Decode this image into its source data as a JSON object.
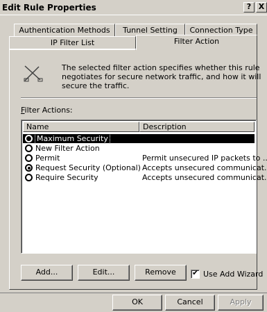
{
  "window": {
    "title": "Edit Rule Properties",
    "help_btn": "?",
    "close_btn": "X"
  },
  "tabs": {
    "row_back": [
      "Authentication Methods",
      "Tunnel Setting",
      "Connection Type"
    ],
    "row_front": [
      "IP Filter List",
      "Filter Action"
    ],
    "active": "Filter Action"
  },
  "info": {
    "icon": "filter-action-icon",
    "text": "The selected filter action specifies whether this rule negotiates for secure network traffic, and how it will secure the traffic."
  },
  "filter_actions": {
    "label_prefix": "",
    "label_underline": "F",
    "label_rest": "ilter Actions:",
    "columns": [
      "Name",
      "Description"
    ],
    "rows": [
      {
        "name": "Maximum Security",
        "description": "",
        "selected": true,
        "checked": false
      },
      {
        "name": "New Filter Action",
        "description": "",
        "selected": false,
        "checked": false
      },
      {
        "name": "Permit",
        "description": "Permit unsecured IP packets to ...",
        "selected": false,
        "checked": false
      },
      {
        "name": "Request Security (Optional)",
        "description": "Accepts unsecured communicat...",
        "selected": false,
        "checked": true
      },
      {
        "name": "Require Security",
        "description": "Accepts unsecured communicat...",
        "selected": false,
        "checked": false
      }
    ]
  },
  "buttons": {
    "add": "Add...",
    "edit": "Edit...",
    "remove": "Remove",
    "use_wizard": "Use Add Wizard",
    "use_wizard_checked": true,
    "ok": "OK",
    "cancel": "Cancel",
    "apply": "Apply"
  }
}
